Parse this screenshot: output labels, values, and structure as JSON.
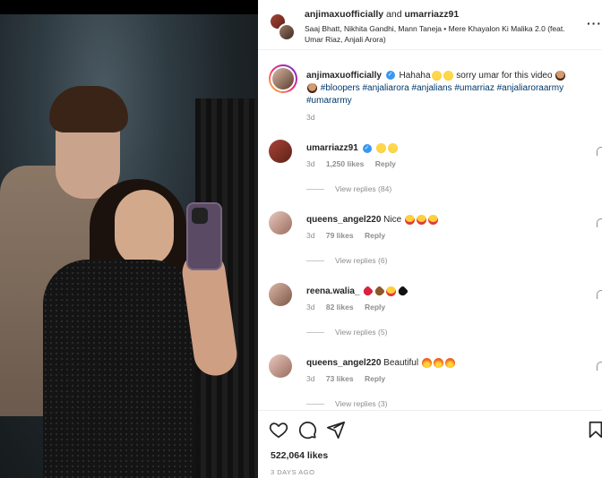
{
  "post": {
    "author": "anjimaxuofficially",
    "and_text": "and",
    "coauthor": "umarriazz91",
    "audio": "Saaj Bhatt, Nikhita Gandhi, Mann Taneja • Mere Khayalon Ki Malika 2.0 (feat. Umar Riaz, Anjali Arora)",
    "more_icon": "more-horizontal-icon"
  },
  "caption": {
    "author": "anjimaxuofficially",
    "text_start": "Hahaha",
    "text_mid": "sorry umar for this video",
    "hashtags": [
      "#bloopers",
      "#anjaliarora",
      "#anjalians",
      "#umarriaz",
      "#anjaliaroraarmy",
      "#umararmy"
    ],
    "time": "3d"
  },
  "comments": [
    {
      "username": "umarriazz91",
      "verified": true,
      "text": "",
      "emojis": [
        "laugh",
        "laugh"
      ],
      "time": "3d",
      "likes": "1,250 likes",
      "reply": "Reply",
      "view_replies": "View replies (84)"
    },
    {
      "username": "queens_angel220",
      "verified": false,
      "text": "Nice",
      "emojis": [
        "heart-eyes",
        "heart-eyes",
        "heart-eyes"
      ],
      "time": "3d",
      "likes": "79 likes",
      "reply": "Reply",
      "view_replies": "View replies (6)"
    },
    {
      "username": "reena.walia_",
      "verified": false,
      "text": "",
      "emojis": [
        "broken",
        "brown",
        "heart-eyes",
        "black"
      ],
      "time": "3d",
      "likes": "82 likes",
      "reply": "Reply",
      "view_replies": "View replies (5)"
    },
    {
      "username": "queens_angel220",
      "verified": false,
      "text": "Beautiful",
      "emojis": [
        "fire",
        "fire",
        "fire"
      ],
      "time": "3d",
      "likes": "73 likes",
      "reply": "Reply",
      "view_replies": "View replies (3)"
    }
  ],
  "actions": {
    "like_icon": "heart-icon",
    "comment_icon": "comment-icon",
    "share_icon": "send-icon",
    "save_icon": "bookmark-icon",
    "likes": "522,064 likes",
    "date": "3 DAYS AGO"
  }
}
